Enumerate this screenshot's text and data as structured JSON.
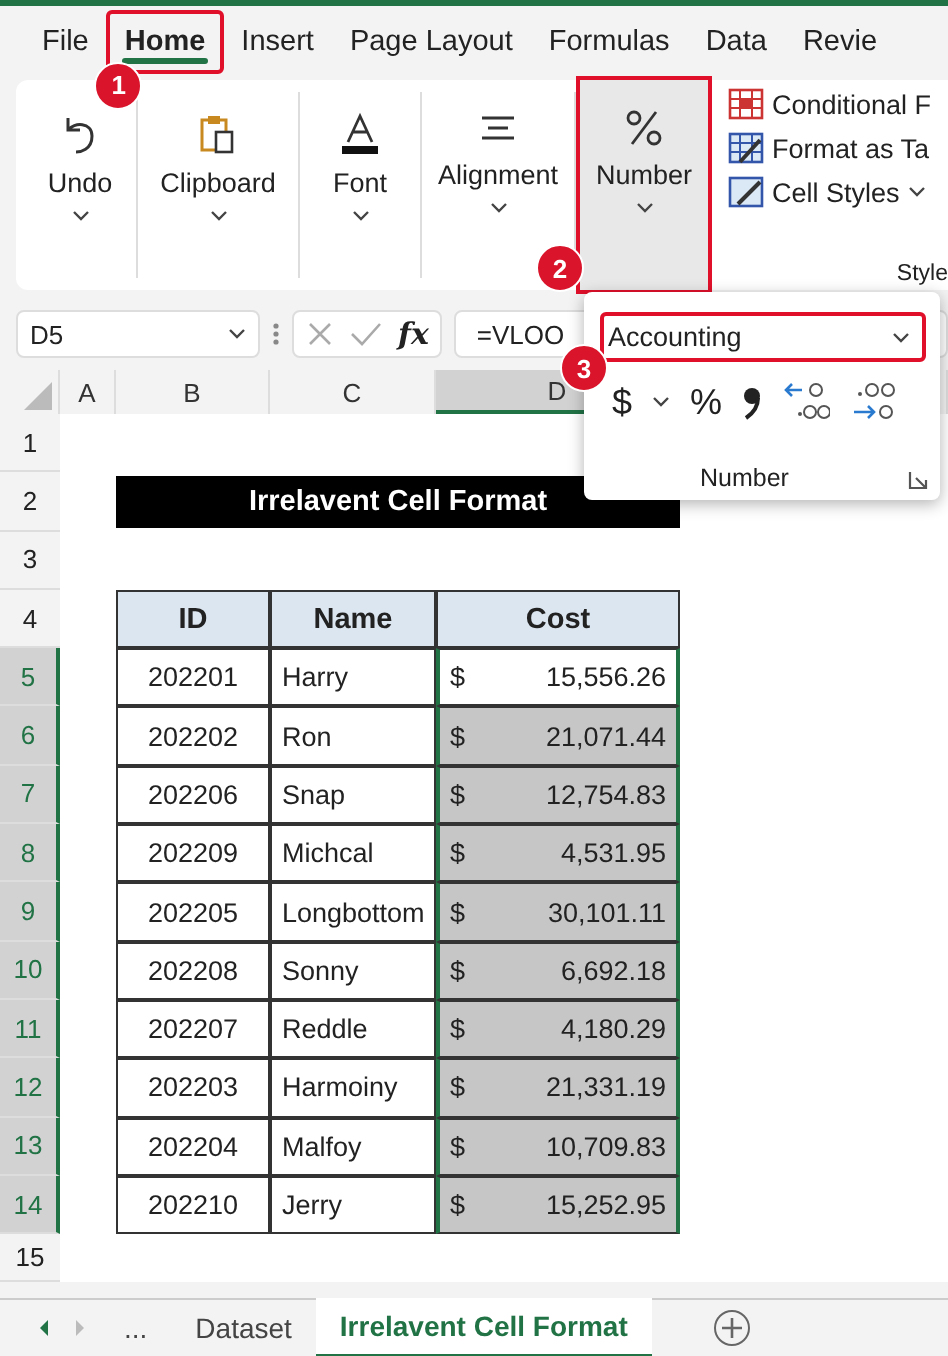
{
  "menu_tabs": [
    {
      "label": "File",
      "selected": false
    },
    {
      "label": "Home",
      "selected": true,
      "annotation": "1"
    },
    {
      "label": "Insert",
      "selected": false
    },
    {
      "label": "Page Layout",
      "selected": false
    },
    {
      "label": "Formulas",
      "selected": false
    },
    {
      "label": "Data",
      "selected": false
    },
    {
      "label": "Revie",
      "selected": false
    }
  ],
  "ribbon": {
    "groups": [
      {
        "kind": "undo",
        "label": "Undo",
        "selected": false
      },
      {
        "kind": "clipboard",
        "label": "Clipboard",
        "selected": false
      },
      {
        "kind": "font",
        "label": "Font",
        "selected": false
      },
      {
        "kind": "alignment",
        "label": "Alignment",
        "selected": false
      },
      {
        "kind": "number",
        "label": "Number",
        "selected": true,
        "annotation": "2"
      }
    ],
    "styles": {
      "items": [
        {
          "kind": "conditional",
          "label": "Conditional F"
        },
        {
          "kind": "table",
          "label": "Format as Ta"
        },
        {
          "kind": "cellstyles",
          "label": "Cell Styles"
        }
      ],
      "label": "Style"
    }
  },
  "formula_bar": {
    "name_box": "D5",
    "fx": "fx",
    "formula": "=VLOO"
  },
  "number_popup": {
    "format": "Accounting",
    "annotation": "3",
    "currency": "$",
    "percent": "%",
    "label": "Number"
  },
  "sheet": {
    "columns": [
      {
        "label": "A",
        "selected": false
      },
      {
        "label": "B",
        "selected": false
      },
      {
        "label": "C",
        "selected": false
      },
      {
        "label": "D",
        "selected": true
      }
    ],
    "row_numbers": [
      {
        "label": "1",
        "selected": false
      },
      {
        "label": "2",
        "selected": false
      },
      {
        "label": "3",
        "selected": false
      },
      {
        "label": "4",
        "selected": false
      },
      {
        "label": "5",
        "selected": true
      },
      {
        "label": "6",
        "selected": true
      },
      {
        "label": "7",
        "selected": true
      },
      {
        "label": "8",
        "selected": true
      },
      {
        "label": "9",
        "selected": true
      },
      {
        "label": "10",
        "selected": true
      },
      {
        "label": "11",
        "selected": true
      },
      {
        "label": "12",
        "selected": true
      },
      {
        "label": "13",
        "selected": true
      },
      {
        "label": "14",
        "selected": true
      },
      {
        "label": "15",
        "selected": false
      }
    ],
    "title": "Irrelavent Cell Format",
    "table": {
      "columns": [
        "ID",
        "Name",
        "Cost"
      ],
      "rows": [
        {
          "id": "202201",
          "name": "Harry",
          "currency": "$",
          "cost": "15,556.26",
          "active": true
        },
        {
          "id": "202202",
          "name": "Ron",
          "currency": "$",
          "cost": "21,071.44",
          "active": false
        },
        {
          "id": "202206",
          "name": "Snap",
          "currency": "$",
          "cost": "12,754.83",
          "active": false
        },
        {
          "id": "202209",
          "name": "Michcal",
          "currency": "$",
          "cost": "4,531.95",
          "active": false
        },
        {
          "id": "202205",
          "name": "Longbottom",
          "currency": "$",
          "cost": "30,101.11",
          "active": false
        },
        {
          "id": "202208",
          "name": "Sonny",
          "currency": "$",
          "cost": "6,692.18",
          "active": false
        },
        {
          "id": "202207",
          "name": "Reddle",
          "currency": "$",
          "cost": "4,180.29",
          "active": false
        },
        {
          "id": "202203",
          "name": "Harmoiny",
          "currency": "$",
          "cost": "21,331.19",
          "active": false
        },
        {
          "id": "202204",
          "name": "Malfoy",
          "currency": "$",
          "cost": "10,709.83",
          "active": false
        },
        {
          "id": "202210",
          "name": "Jerry",
          "currency": "$",
          "cost": "15,252.95",
          "active": false
        }
      ]
    }
  },
  "sheet_tabs": {
    "overflow": "...",
    "tabs": [
      {
        "label": "Dataset",
        "selected": false
      },
      {
        "label": "Irrelavent Cell Format",
        "selected": true
      }
    ]
  }
}
